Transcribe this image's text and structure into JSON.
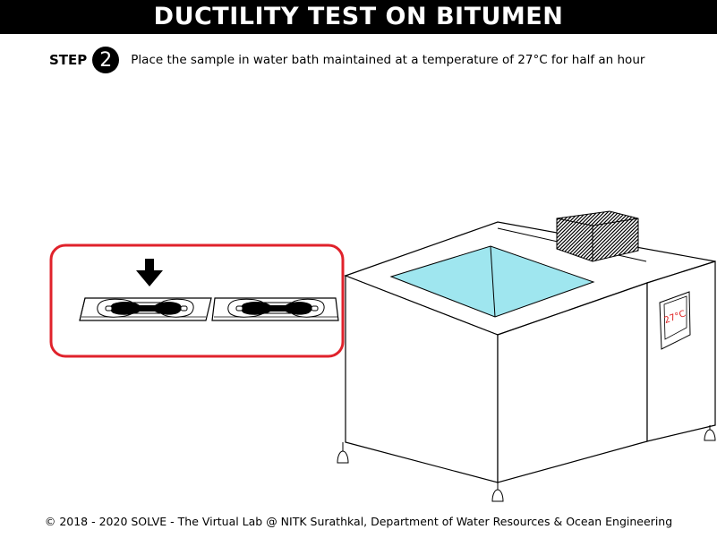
{
  "title": "DUCTILITY TEST ON BITUMEN",
  "step": {
    "label": "STEP",
    "number": "2",
    "instruction": "Place the sample in water bath maintained at a temperature of 27°C for half an hour"
  },
  "water_bath": {
    "display_temp": "27°C",
    "water_color": "#9fe6ef",
    "display_color": "#e02020"
  },
  "highlight_color": "#e0222b",
  "footer": "© 2018 - 2020 SOLVE - The Virtual Lab @ NITK Surathkal, Department of Water Resources & Ocean Engineering"
}
